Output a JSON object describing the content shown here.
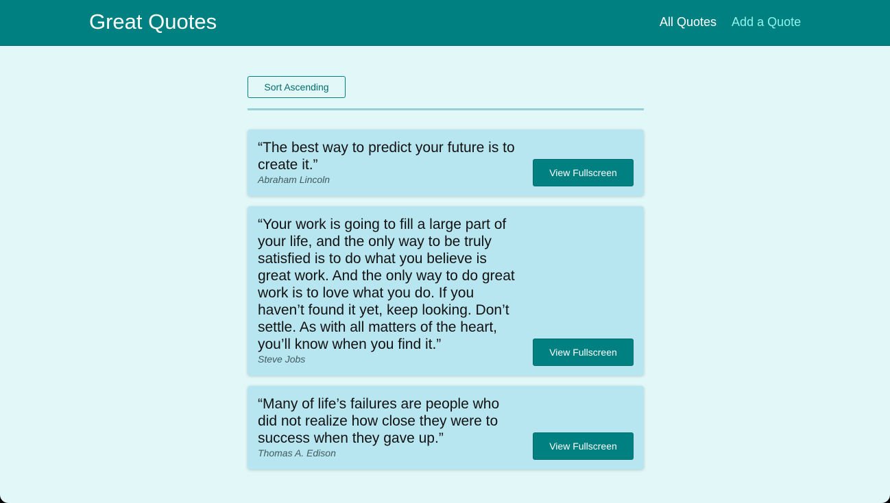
{
  "header": {
    "logo": "Great Quotes",
    "nav": [
      {
        "label": "All Quotes",
        "active": true
      },
      {
        "label": "Add a Quote",
        "active": false
      }
    ]
  },
  "toolbar": {
    "sort_label": "Sort Ascending"
  },
  "quotes": [
    {
      "text": "“The best way to predict your future is to create it.”",
      "author": "Abraham Lincoln",
      "button_label": "View Fullscreen"
    },
    {
      "text": "“Your work is going to fill a large part of your life, and the only way to be truly satisfied is to do what you believe is great work. And the only way to do great work is to love what you do. If you haven’t found it yet, keep looking. Don’t settle. As with all matters of the heart, you’ll know when you find it.”",
      "author": "Steve Jobs",
      "button_label": "View Fullscreen"
    },
    {
      "text": "“Many of life’s failures are people who did not realize how close they were to success when they gave up.”",
      "author": "Thomas A. Edison",
      "button_label": "View Fullscreen"
    }
  ],
  "colors": {
    "header_background": "#008080",
    "page_background": "#e1f7f8",
    "card_background": "#b8e6f0",
    "accent": "#008080",
    "inactive_nav": "#8ef3eb"
  }
}
